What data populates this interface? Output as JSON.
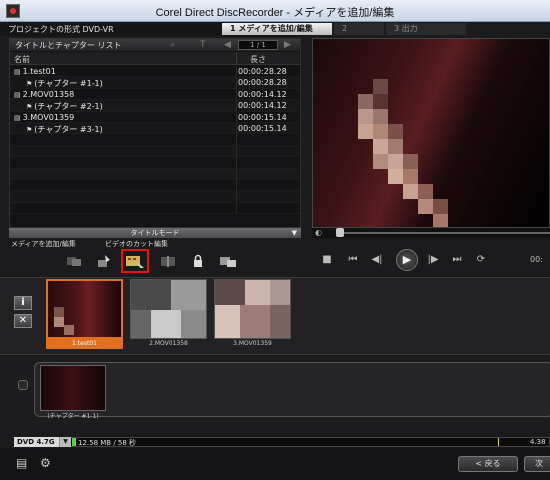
{
  "window": {
    "title": "Corel Direct DiscRecorder - メディアを追加/編集"
  },
  "project": {
    "label": "プロジェクトの形式 DVD-VR"
  },
  "steps": [
    {
      "label": "1 メディアを追加/編集",
      "active": true
    },
    {
      "label": "2",
      "active": false
    },
    {
      "label": "3 出力",
      "active": false
    }
  ],
  "list": {
    "title": "タイトルとチャプター リスト",
    "page": "1 / 1",
    "col_name": "名前",
    "col_length": "長さ",
    "rows": [
      {
        "type": "title",
        "name": "1.test01",
        "length": "00:00:28.28"
      },
      {
        "type": "chapter",
        "name": "(チャプター #1-1)",
        "length": "00:00:28.28"
      },
      {
        "type": "title",
        "name": "2.MOV01358",
        "length": "00:00:14.12"
      },
      {
        "type": "chapter",
        "name": "(チャプター #2-1)",
        "length": "00:00:14.12"
      },
      {
        "type": "title",
        "name": "3.MOV01359",
        "length": "00:00:15.14"
      },
      {
        "type": "chapter",
        "name": "(チャプター #3-1)",
        "length": "00:00:15.14"
      }
    ]
  },
  "mode_bar": {
    "label": "タイトルモード"
  },
  "tool_labels": {
    "add": "メディアを追加/編集",
    "cut": "ビデオのカット編集"
  },
  "tools": [
    {
      "icon": "media-tool-icon"
    },
    {
      "icon": "edit-tool-icon"
    },
    {
      "icon": "cut-edit-icon",
      "highlighted": true
    },
    {
      "icon": "split-icon"
    },
    {
      "icon": "lock-icon"
    },
    {
      "icon": "chapter-tool-icon"
    }
  ],
  "side_buttons": {
    "info": "i",
    "close": "✕"
  },
  "clips": [
    {
      "caption": "1.test01",
      "selected": true
    },
    {
      "caption": "2.MOV01358",
      "selected": false
    },
    {
      "caption": "3.MOV01359",
      "selected": false
    }
  ],
  "chapters": [
    {
      "caption": "(チャプター #1-1)"
    }
  ],
  "capacity": {
    "disc": "DVD 4.7G",
    "used": "12.58 MB / 58 秒",
    "end": "4.38"
  },
  "bottom": {
    "back_label": "< 戻る",
    "next_label": "次"
  },
  "colors": {
    "accent_orange": "#e0701f",
    "highlight_red": "#e81414",
    "capacity_green": "#5ad34a"
  }
}
